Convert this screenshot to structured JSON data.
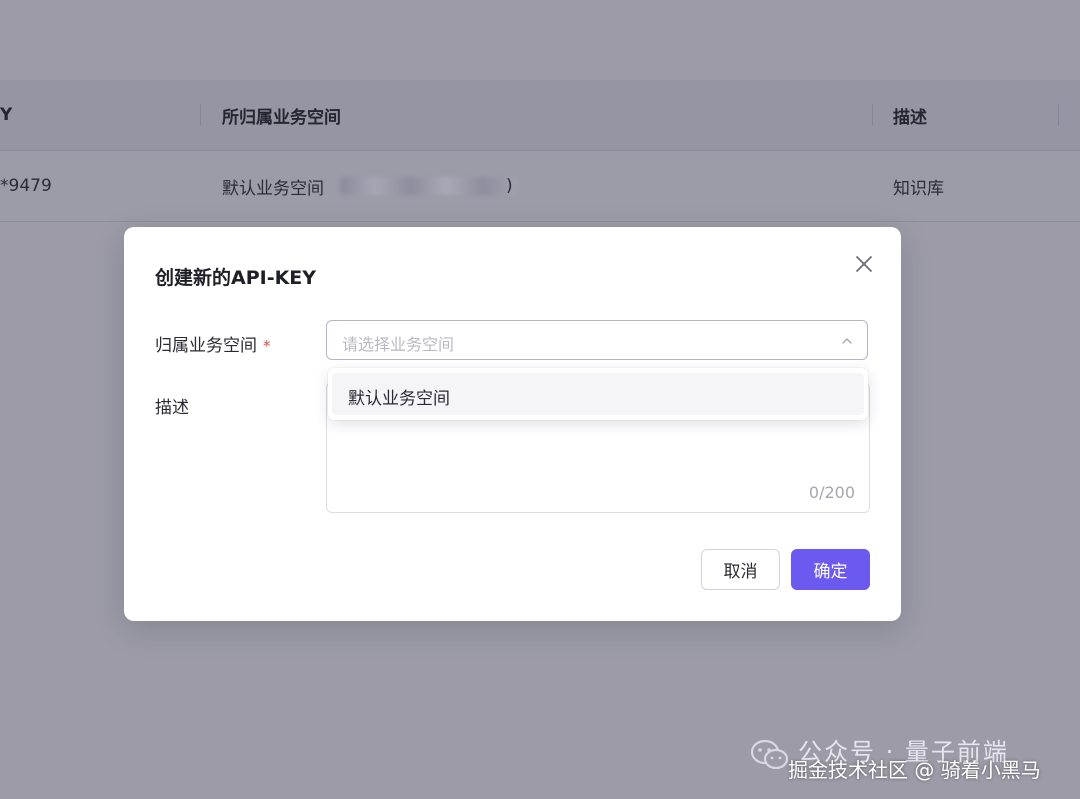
{
  "table": {
    "headers": {
      "key_col": "Y",
      "workspace_col": "所归属业务空间",
      "desc_col": "描述"
    },
    "row": {
      "key_value": "*9479",
      "workspace_value": "默认业务空间",
      "workspace_suffix": ")",
      "desc_value": "知识库"
    }
  },
  "modal": {
    "title": "创建新的API-KEY",
    "close_icon": "close-icon",
    "workspace_label": "归属业务空间",
    "required_mark": "*",
    "workspace_placeholder": "请选择业务空间",
    "dropdown_options": [
      "默认业务空间"
    ],
    "desc_label": "描述",
    "char_count": "0/200",
    "cancel_label": "取消",
    "confirm_label": "确定"
  },
  "watermark": {
    "line1": "公众号 · 量子前端",
    "line2": "掘金技术社区 @ 骑着小黑马"
  },
  "colors": {
    "overlay": "#9c9ba7",
    "primary": "#6b59f0",
    "required": "#e2493f"
  }
}
